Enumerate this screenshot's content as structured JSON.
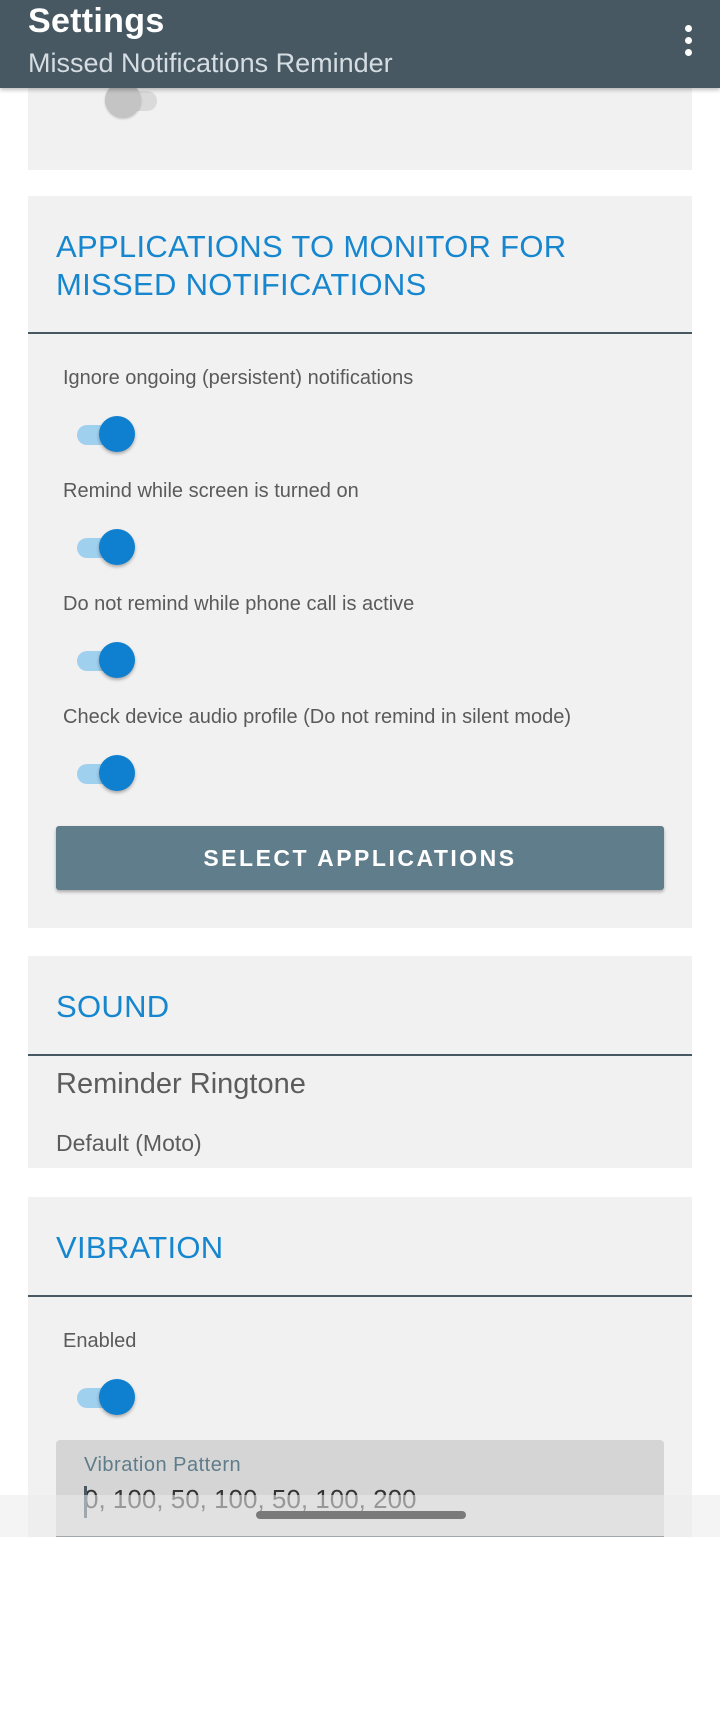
{
  "appbar": {
    "title": "Settings",
    "subtitle": "Missed Notifications Reminder",
    "menu_icon": "more-vert-icon"
  },
  "top_card": {
    "switch_state": "off"
  },
  "applications_section": {
    "title": "APPLICATIONS TO MONITOR FOR MISSED NOTIFICATIONS",
    "prefs": [
      {
        "label": "Ignore ongoing (persistent) notifications",
        "enabled": true
      },
      {
        "label": "Remind while screen is turned on",
        "enabled": true
      },
      {
        "label": "Do not remind while phone call is active",
        "enabled": true
      },
      {
        "label": "Check device audio profile (Do not remind in silent mode)",
        "enabled": true
      }
    ],
    "button_label": "SELECT APPLICATIONS"
  },
  "sound_section": {
    "title": "SOUND",
    "ringtone_title": "Reminder Ringtone",
    "ringtone_value": "Default (Moto)"
  },
  "vibration_section": {
    "title": "VIBRATION",
    "enabled_label": "Enabled",
    "enabled": true,
    "pattern_label": "Vibration Pattern",
    "pattern_value": "0, 100, 50, 100, 50, 100, 200"
  },
  "colors": {
    "appbar": "#475863",
    "accent": "#1686cf",
    "switch_on": "#0f7fcf",
    "button": "#607d8b",
    "card": "#f1f1f1"
  }
}
